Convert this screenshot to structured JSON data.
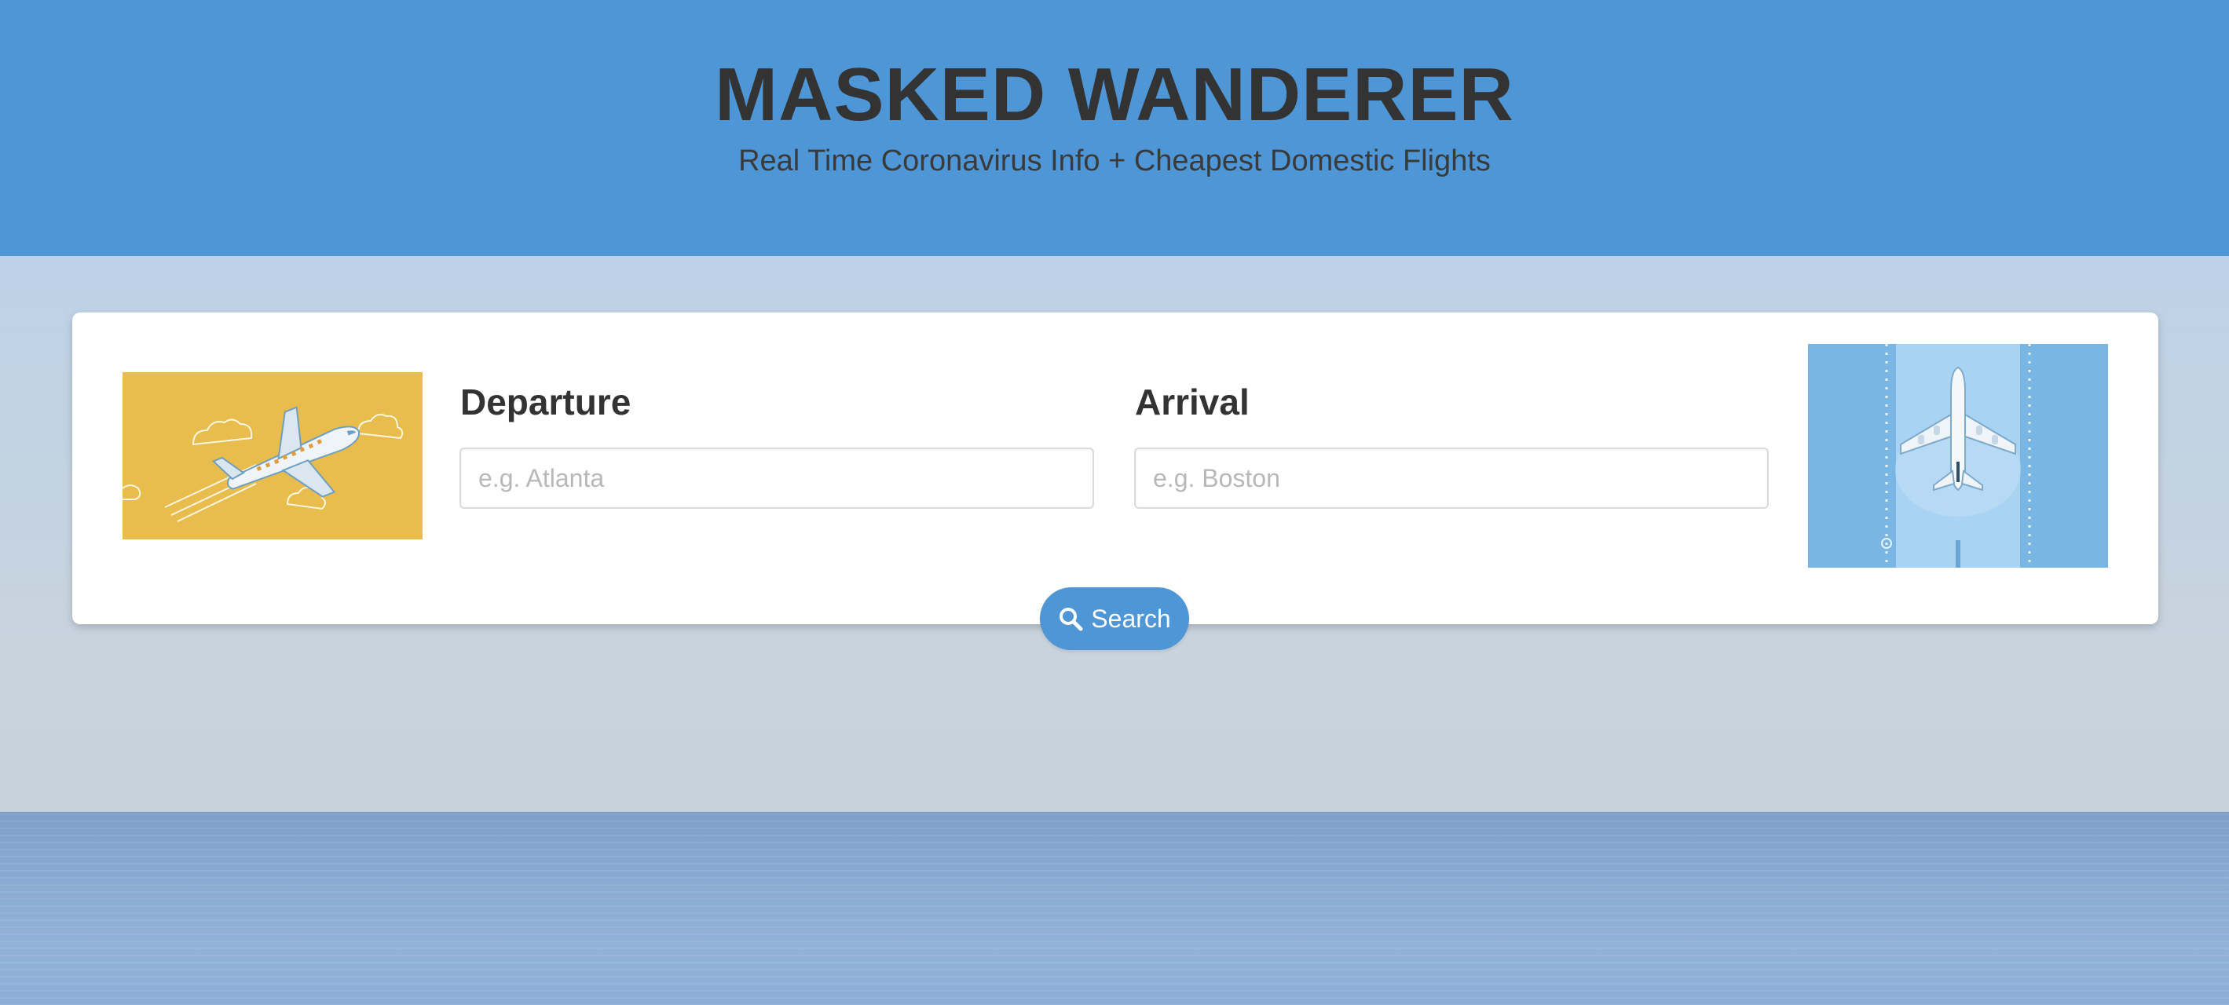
{
  "header": {
    "title": "MASKED WANDERER",
    "subtitle": "Real Time Coronavirus Info + Cheapest Domestic Flights",
    "background_color": "#4e96d5"
  },
  "form": {
    "departure": {
      "label": "Departure",
      "placeholder": "e.g. Atlanta",
      "value": ""
    },
    "arrival": {
      "label": "Arrival",
      "placeholder": "e.g. Boston",
      "value": ""
    },
    "search_button": {
      "label": "Search",
      "icon": "search-icon",
      "color": "#4e96d5"
    }
  },
  "images": {
    "left": {
      "icon": "airplane-flying-illustration",
      "background": "#e8bd4e"
    },
    "right": {
      "icon": "airplane-runway-illustration",
      "background": "#79b6e4"
    }
  },
  "background": {
    "scene": "sky-and-sea"
  }
}
